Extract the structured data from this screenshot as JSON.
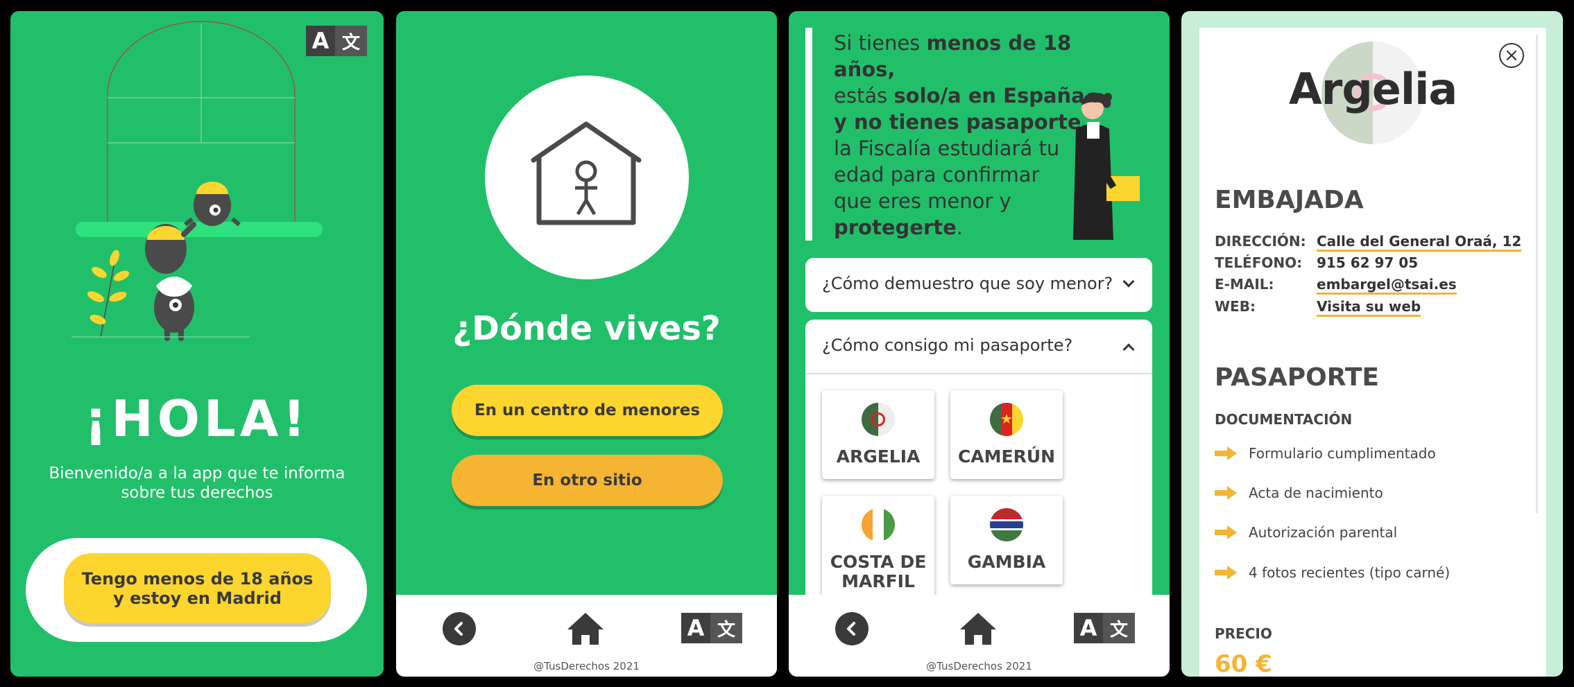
{
  "screen1": {
    "translate_icon": {
      "left": "A",
      "right": "文"
    },
    "greeting": "¡HOLA!",
    "welcome_line1": "Bienvenido/a a la app que te informa",
    "welcome_line2": "sobre tus derechos",
    "cta_line1": "Tengo menos de 18 años",
    "cta_line2": "y estoy en Madrid"
  },
  "screen2": {
    "question": "¿Dónde vives?",
    "option1": "En un centro de menores",
    "option2": "En otro sitio",
    "footer": "@TusDerechos 2021"
  },
  "screen3": {
    "intro": {
      "l1a": "Si tienes ",
      "l1b": "menos de 18",
      "l2": "años,",
      "l3a": "estás ",
      "l3b": "solo/a en España",
      "l4a": "y ",
      "l4b": "no tienes pasaporte,",
      "l5": "la Fiscalía estudiará tu",
      "l6": "edad para confirmar",
      "l7": "que eres menor y",
      "l8": "protegerte",
      "l8b": "."
    },
    "faq1": "¿Cómo demuestro que soy menor?",
    "faq2": "¿Cómo consigo mi pasaporte?",
    "countries": [
      "ARGELIA",
      "CAMERÚN",
      "COSTA DE",
      "MARFIL",
      "GAMBIA"
    ],
    "footer": "@TusDerechos 2021"
  },
  "screen4": {
    "country_title": "Argelia",
    "embassy_title": "EMBAJADA",
    "labels": {
      "address": "DIRECCIÓN:",
      "phone": "TELÉFONO:",
      "email": "E-MAIL:",
      "web": "WEB:"
    },
    "values": {
      "address": "Calle del General Oraá, 12",
      "phone": "915 62 97 05",
      "email": "embargel@tsai.es",
      "web": "Visita su web"
    },
    "passport_title": "PASAPORTE",
    "documentation_label": "DOCUMENTACIÓN",
    "documents": [
      "Formulario cumplimentado",
      "Acta de nacimiento",
      "Autorización parental",
      "4 fotos recientes (tipo carné)"
    ],
    "price_label": "PRECIO",
    "price": "60 €"
  },
  "colors": {
    "green": "#22bf6a",
    "yellow": "#fdd52f",
    "orange": "#f5b431",
    "dark": "#3a3a3a",
    "mint": "#c7eed6"
  }
}
